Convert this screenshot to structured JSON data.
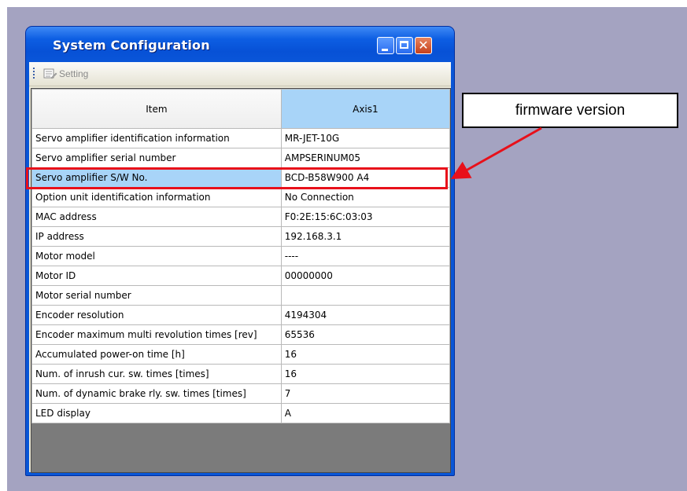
{
  "window": {
    "title": "System Configuration",
    "controls": {
      "minimize_icon": "minimize-icon",
      "maximize_icon": "maximize-icon",
      "close_icon": "close-icon",
      "close_glyph": "✕"
    }
  },
  "toolbar": {
    "setting_label": "Setting",
    "setting_icon": "setting-icon"
  },
  "grid": {
    "headers": [
      "Item",
      "Axis1"
    ],
    "rows": [
      {
        "item": "Servo amplifier identification information",
        "value": "MR-JET-10G"
      },
      {
        "item": "Servo amplifier serial number",
        "value": "AMPSERINUM05"
      },
      {
        "item": "Servo amplifier S/W No.",
        "value": "BCD-B58W900 A4"
      },
      {
        "item": "Option unit identification information",
        "value": "No Connection"
      },
      {
        "item": "MAC address",
        "value": "F0:2E:15:6C:03:03"
      },
      {
        "item": "IP address",
        "value": "192.168.3.1"
      },
      {
        "item": "Motor model",
        "value": "----"
      },
      {
        "item": "Motor ID",
        "value": "00000000"
      },
      {
        "item": "Motor serial number",
        "value": ""
      },
      {
        "item": "Encoder resolution",
        "value": "4194304"
      },
      {
        "item": "Encoder maximum multi revolution times [rev]",
        "value": "65536"
      },
      {
        "item": "Accumulated power-on time [h]",
        "value": "16"
      },
      {
        "item": "Num. of inrush cur. sw. times [times]",
        "value": "16"
      },
      {
        "item": "Num. of dynamic brake rly. sw. times [times]",
        "value": "7"
      },
      {
        "item": "LED display",
        "value": "A"
      }
    ],
    "selected_row": 2
  },
  "annotation": {
    "callout_text": "firmware version",
    "color": "#e8101a"
  }
}
